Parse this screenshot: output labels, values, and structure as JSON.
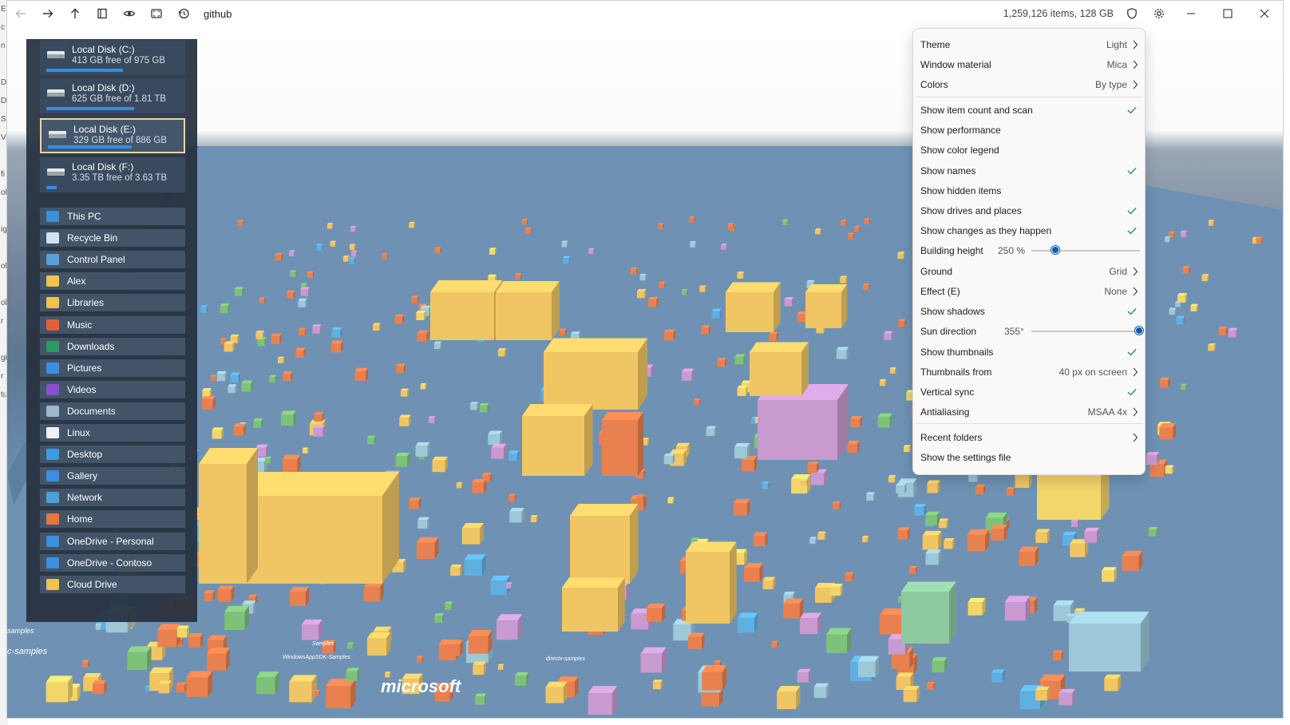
{
  "window": {
    "path": "github",
    "status": "1,259,126 items, 128 GB"
  },
  "icons": {
    "back": "arrow-left-icon",
    "forward": "arrow-right-icon",
    "up": "arrow-up-icon",
    "bookmark": "bookmark-icon",
    "eye": "eye-icon",
    "fullscreen": "fullscreen-icon",
    "history": "history-icon",
    "shield": "shield-icon",
    "settings": "gear-icon"
  },
  "drives": [
    {
      "name": "Local Disk (C:)",
      "free": "413 GB free of 975 GB",
      "used_fraction": 0.58,
      "selected": false
    },
    {
      "name": "Local Disk (D:)",
      "free": "625 GB free of 1.81 TB",
      "used_fraction": 0.66,
      "selected": false
    },
    {
      "name": "Local Disk (E:)",
      "free": "329 GB free of 886 GB",
      "used_fraction": 0.63,
      "selected": true
    },
    {
      "name": "Local Disk (F:)",
      "free": "3.35 TB free of 3.63 TB",
      "used_fraction": 0.08,
      "selected": false
    }
  ],
  "places": [
    {
      "label": "This PC",
      "color": "#3d8fd9"
    },
    {
      "label": "Recycle Bin",
      "color": "#cfe3f5"
    },
    {
      "label": "Control Panel",
      "color": "#5aa0dd"
    },
    {
      "label": "Alex",
      "color": "#f2c14e"
    },
    {
      "label": "Libraries",
      "color": "#f2c14e"
    },
    {
      "label": "Music",
      "color": "#e0603a"
    },
    {
      "label": "Downloads",
      "color": "#2e9a63"
    },
    {
      "label": "Pictures",
      "color": "#3a8fe0"
    },
    {
      "label": "Videos",
      "color": "#8a4fd0"
    },
    {
      "label": "Documents",
      "color": "#9fb6cc"
    },
    {
      "label": "Linux",
      "color": "#f0f0f0"
    },
    {
      "label": "Desktop",
      "color": "#3a9be8"
    },
    {
      "label": "Gallery",
      "color": "#3a8fe0"
    },
    {
      "label": "Network",
      "color": "#4aa0d8"
    },
    {
      "label": "Home",
      "color": "#e7773c"
    },
    {
      "label": "OneDrive - Personal",
      "color": "#3a8fe0"
    },
    {
      "label": "OneDrive - Contoso",
      "color": "#3a8fe0"
    },
    {
      "label": "Cloud Drive",
      "color": "#f2c14e"
    }
  ],
  "menu": {
    "theme": {
      "label": "Theme",
      "value": "Light"
    },
    "window_material": {
      "label": "Window material",
      "value": "Mica"
    },
    "colors": {
      "label": "Colors",
      "value": "By type"
    },
    "show_item_count": {
      "label": "Show item count and scan",
      "checked": true
    },
    "show_performance": {
      "label": "Show performance",
      "checked": false
    },
    "show_color_legend": {
      "label": "Show color legend",
      "checked": false
    },
    "show_names": {
      "label": "Show names",
      "checked": true
    },
    "show_hidden": {
      "label": "Show hidden items",
      "checked": false
    },
    "show_drives": {
      "label": "Show drives and places",
      "checked": true
    },
    "show_changes": {
      "label": "Show changes as they happen",
      "checked": true
    },
    "building_height": {
      "label": "Building height",
      "value": "250 %",
      "level": 0.22
    },
    "ground": {
      "label": "Ground",
      "value": "Grid"
    },
    "effect": {
      "label": "Effect (E)",
      "value": "None"
    },
    "show_shadows": {
      "label": "Show shadows",
      "checked": true
    },
    "sun_direction": {
      "label": "Sun direction",
      "value": "355°",
      "level": 0.99
    },
    "show_thumbnails": {
      "label": "Show thumbnails",
      "checked": true
    },
    "thumbnails_from": {
      "label": "Thumbnails from",
      "value": "40 px on screen"
    },
    "vertical_sync": {
      "label": "Vertical sync",
      "checked": true
    },
    "antialiasing": {
      "label": "Antialiasing",
      "value": "MSAA 4x"
    },
    "recent_folders": {
      "label": "Recent folders"
    },
    "show_settings_file": {
      "label": "Show the settings file"
    }
  },
  "city_labels": {
    "samples_left": "samples",
    "c_samples": "c-samples",
    "samples": "Samples",
    "windowsappsdk": "WindowsAppSDK-Samples",
    "directx": "directx-samples",
    "microsoft": "microsoft"
  },
  "background_window_letters": [
    "E",
    "c",
    "n",
    "",
    "D",
    "D",
    "S",
    "V",
    "",
    "fi",
    "ol",
    "",
    "ig",
    "",
    "ol",
    "",
    "ol",
    "r",
    "",
    "gi",
    "r",
    "tu"
  ]
}
